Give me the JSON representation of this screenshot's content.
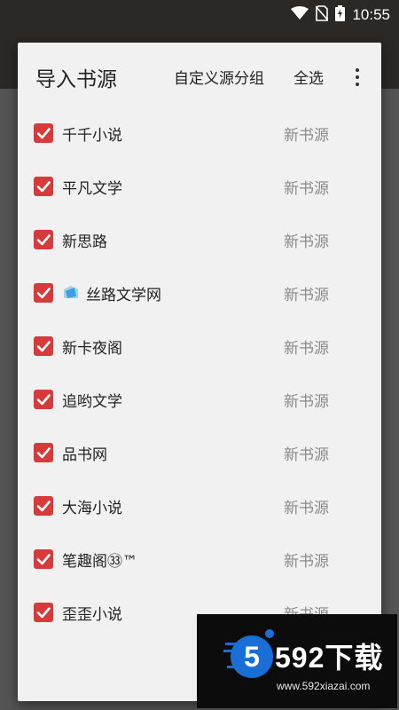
{
  "status_bar": {
    "time": "10:55"
  },
  "dialog": {
    "title": "导入书源",
    "actions": {
      "custom_group": "自定义源分组",
      "select_all": "全选"
    },
    "items": [
      {
        "name": "千千小说",
        "group": "新书源",
        "checked": true
      },
      {
        "name": "平凡文学",
        "group": "新书源",
        "checked": true
      },
      {
        "name": "新思路",
        "group": "新书源",
        "checked": true
      },
      {
        "name": "丝路文学网",
        "group": "新书源",
        "checked": true
      },
      {
        "name": "新卡夜阁",
        "group": "新书源",
        "checked": true
      },
      {
        "name": "追哟文学",
        "group": "新书源",
        "checked": true
      },
      {
        "name": "品书网",
        "group": "新书源",
        "checked": true
      },
      {
        "name": "大海小说",
        "group": "新书源",
        "checked": true
      },
      {
        "name": "笔趣阁㉝™",
        "group": "新书源",
        "checked": true
      },
      {
        "name": "歪歪小说",
        "group": "新书源",
        "checked": true
      }
    ]
  },
  "watermark": {
    "title": "592下载",
    "url": "www.592xiazai.com",
    "logo_digit": "5"
  },
  "colors": {
    "checkbox": "#d63a3a",
    "dialog_bg": "#f1f1f1",
    "secondary_text": "#8a8a8a"
  }
}
